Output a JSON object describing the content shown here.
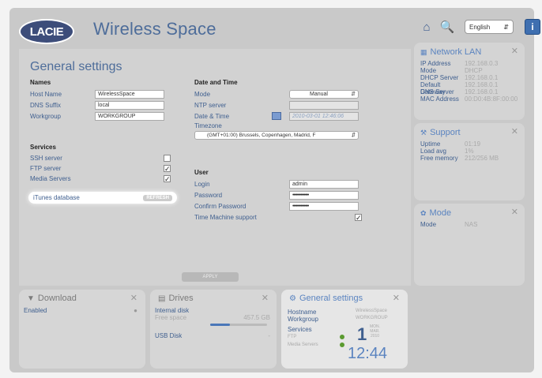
{
  "header": {
    "logo_text": "LACIE",
    "app_title": "Wireless Space",
    "language": "English",
    "info_label": "i"
  },
  "general_settings": {
    "title": "General settings",
    "names": {
      "header": "Names",
      "host_name_label": "Host Name",
      "host_name_value": "WirelessSpace",
      "dns_suffix_label": "DNS Suffix",
      "dns_suffix_value": "local",
      "workgroup_label": "Workgroup",
      "workgroup_value": "WORKGROUP"
    },
    "services": {
      "header": "Services",
      "ssh_label": "SSH server",
      "ssh_checked": false,
      "ftp_label": "FTP server",
      "ftp_checked": true,
      "media_label": "Media Servers",
      "media_checked": true,
      "itunes_label": "iTunes database",
      "refresh_label": "REFRESH"
    },
    "date_time": {
      "header": "Date and Time",
      "mode_label": "Mode",
      "mode_value": "Manual",
      "ntp_label": "NTP server",
      "ntp_value": "",
      "datetime_label": "Date & Time",
      "datetime_value": "2010-03-01 12:46:06",
      "timezone_label": "Timezone",
      "timezone_value": "(GMT+01:00) Brussels, Copenhagen, Madrid, F"
    },
    "user": {
      "header": "User",
      "login_label": "Login",
      "login_value": "admin",
      "password_label": "Password",
      "password_value": "••••••••••••••",
      "confirm_label": "Confirm Password",
      "confirm_value": "••••••••••••••",
      "tm_label": "Time Machine support",
      "tm_checked": true
    },
    "apply_label": "APPLY"
  },
  "network_widget": {
    "title": "Network LAN",
    "rows": [
      {
        "k": "IP Address",
        "v": "192.168.0.3"
      },
      {
        "k": "Mode",
        "v": "DHCP"
      },
      {
        "k": "DHCP Server",
        "v": "192.168.0.1"
      },
      {
        "k": "Default Gateway",
        "v": "192.168.0.1"
      },
      {
        "k": "DNS Server",
        "v": "192.168.0.1"
      },
      {
        "k": "MAC Address",
        "v": "00:D0:4B:8F:00:00"
      }
    ]
  },
  "support_widget": {
    "title": "Support",
    "rows": [
      {
        "k": "Uptime",
        "v": "01:19"
      },
      {
        "k": "Load avg",
        "v": "1%"
      },
      {
        "k": "Free memory",
        "v": "212/256 MB"
      }
    ]
  },
  "mode_widget": {
    "title": "Mode",
    "rows": [
      {
        "k": "Mode",
        "v": "NAS"
      }
    ]
  },
  "download_widget": {
    "title": "Download",
    "status": "Enabled"
  },
  "drives_widget": {
    "title": "Drives",
    "internal_label": "Internal disk",
    "free_label": "Free space",
    "free_value": "457.5 GB",
    "usb_label": "USB Disk",
    "usb_value": "-",
    "usage_fraction": 0.35
  },
  "gs_widget": {
    "title": "General settings",
    "hostname_label": "Hostname",
    "hostname_value": "WirelessSpace",
    "workgroup_label": "Workgroup",
    "workgroup_value": "WORKGROUP",
    "services_label": "Services",
    "ftp_label": "FTP",
    "media_label": "Media Servers",
    "day": "1",
    "weekday": "MON.",
    "month": "MAR.",
    "year": "2010",
    "time": "12:44"
  },
  "colors": {
    "accent": "#4e6d9a",
    "link_blue": "#3f5f8f",
    "status_green": "#5a9a2f"
  }
}
